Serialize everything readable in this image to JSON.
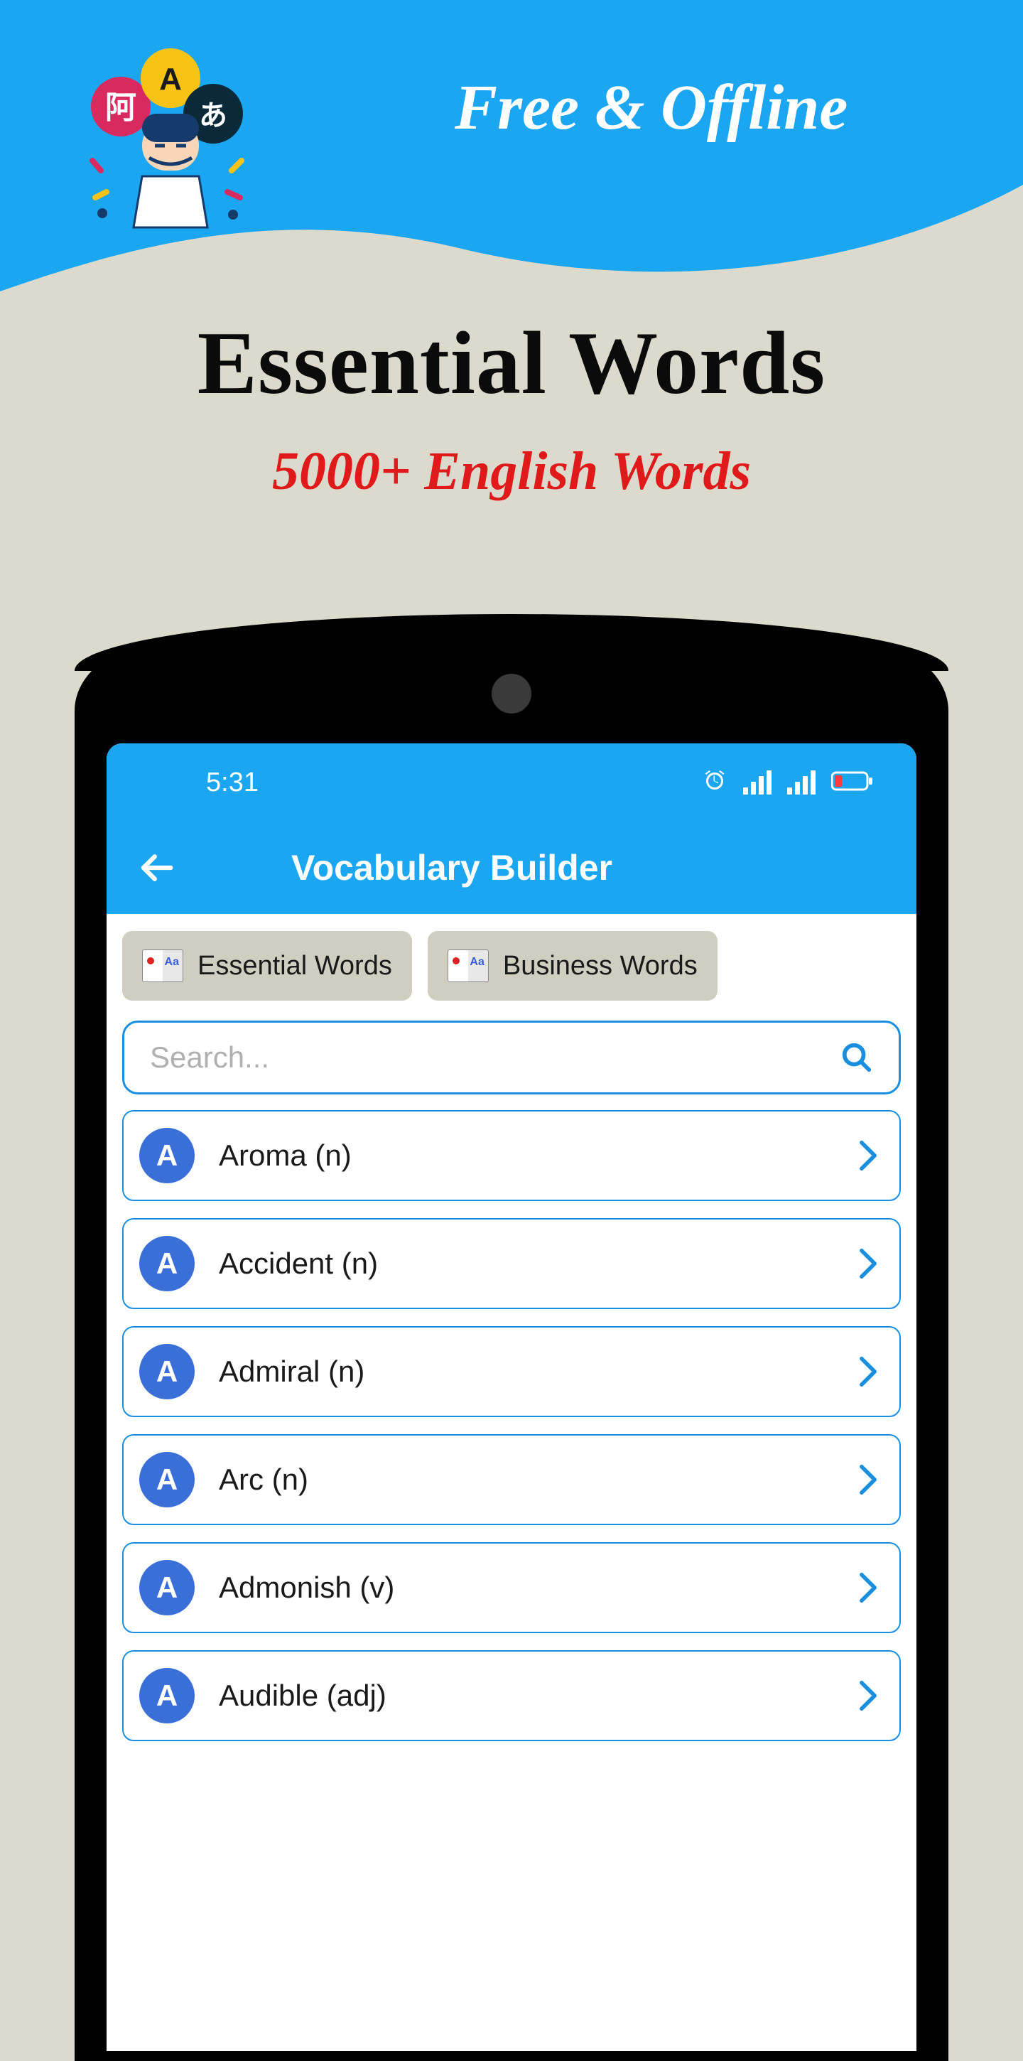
{
  "banner": {
    "tagline": "Free & Offline"
  },
  "hero": {
    "title": "Essential Words",
    "subtitle": "5000+ English Words"
  },
  "statusbar": {
    "time": "5:31"
  },
  "appbar": {
    "title": "Vocabulary Builder"
  },
  "chips": [
    {
      "label": "Essential Words"
    },
    {
      "label": "Business Words"
    }
  ],
  "search": {
    "placeholder": "Search..."
  },
  "words": [
    {
      "letter": "A",
      "label": "Aroma (n)"
    },
    {
      "letter": "A",
      "label": "Accident (n)"
    },
    {
      "letter": "A",
      "label": "Admiral (n)"
    },
    {
      "letter": "A",
      "label": "Arc (n)"
    },
    {
      "letter": "A",
      "label": "Admonish (v)"
    },
    {
      "letter": "A",
      "label": "Audible (adj)"
    }
  ]
}
